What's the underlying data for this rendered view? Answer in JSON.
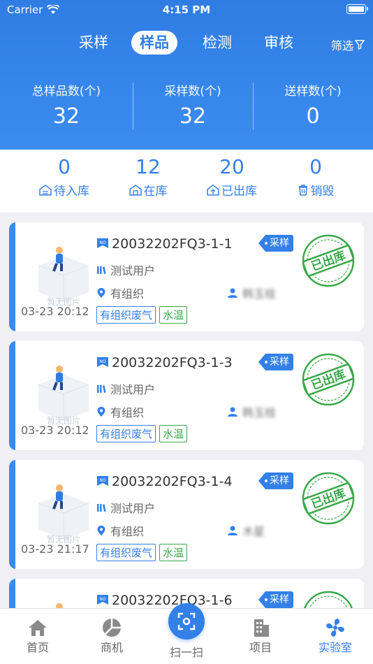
{
  "status": {
    "carrier": "Carrier",
    "time": "4:15 PM"
  },
  "tabs": [
    "采样",
    "样品",
    "检测",
    "审核"
  ],
  "filter_label": "筛选",
  "stats": [
    {
      "label": "总样品数(个)",
      "value": "32"
    },
    {
      "label": "采样数(个)",
      "value": "32"
    },
    {
      "label": "送样数(个)",
      "value": "0"
    }
  ],
  "storage": [
    {
      "value": "0",
      "label": "待入库"
    },
    {
      "value": "12",
      "label": "在库"
    },
    {
      "value": "20",
      "label": "已出库"
    },
    {
      "value": "0",
      "label": "销毁"
    }
  ],
  "no_image_text": "暂无图片",
  "stamp_text": "已出库",
  "cards": [
    {
      "code": "20032202FQ3-1-1",
      "user": "测试用户",
      "org": "有组织",
      "person": "韩玉桂",
      "date": "03-23 20:12",
      "tag1": "有组织废气",
      "tag2": "水温",
      "chip": "采样"
    },
    {
      "code": "20032202FQ3-1-3",
      "user": "测试用户",
      "org": "有组织",
      "person": "韩玉桂",
      "date": "03-23 20:12",
      "tag1": "有组织废气",
      "tag2": "水温",
      "chip": "采样"
    },
    {
      "code": "20032202FQ3-1-4",
      "user": "测试用户",
      "org": "有组织",
      "person": "木星",
      "date": "03-23 21:17",
      "tag1": "有组织废气",
      "tag2": "水温",
      "chip": "采样"
    },
    {
      "code": "20032202FQ3-1-6",
      "chip": "采样"
    }
  ],
  "bottom_nav": [
    "首页",
    "商机",
    "扫一扫",
    "项目",
    "实验室"
  ],
  "colors": {
    "primary": "#3380e8",
    "green": "#39a849"
  }
}
